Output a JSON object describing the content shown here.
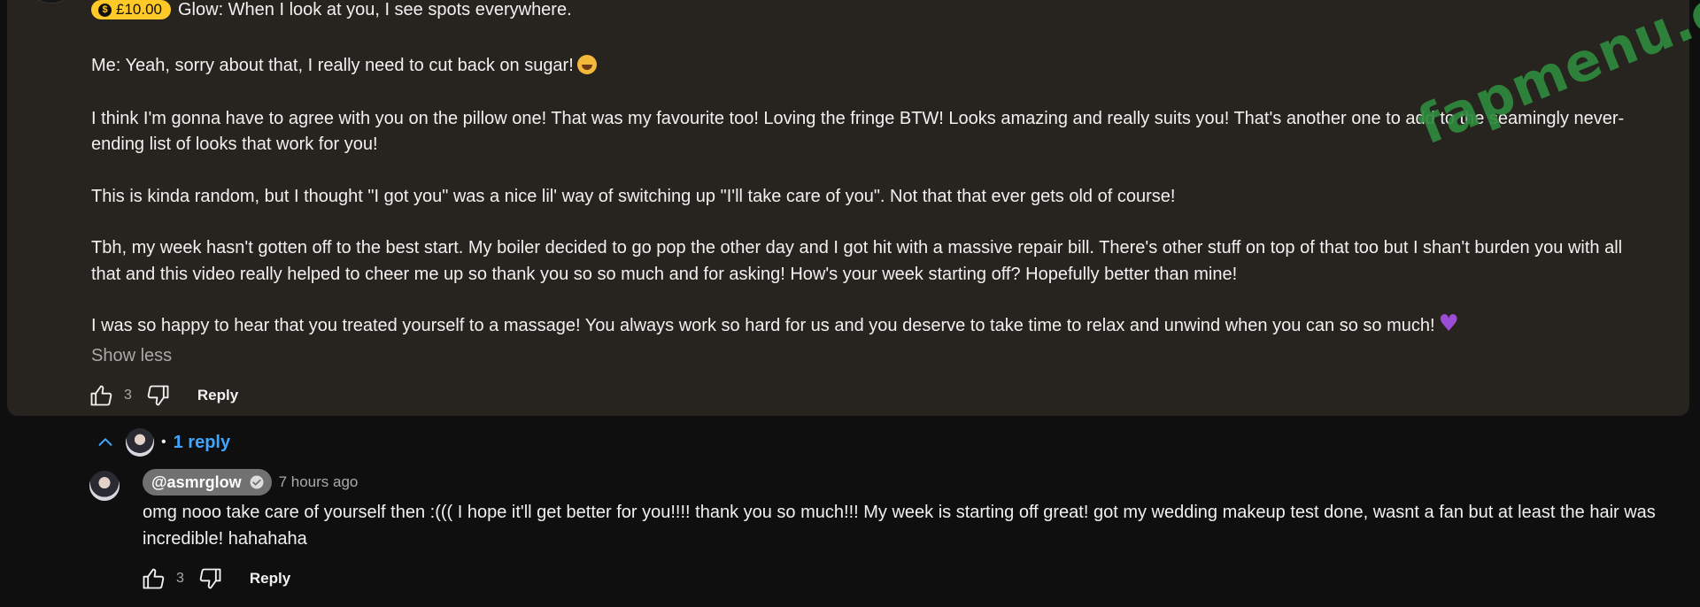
{
  "comment": {
    "super_chat_amount": "£10.00",
    "paragraphs": [
      "Glow: When I look at you, I see spots everywhere.",
      "Me: Yeah, sorry about that, I really need to cut back on sugar!",
      "I think I'm gonna have to agree with you on the pillow one! That was my favourite too! Loving the fringe BTW! Looks amazing and really suits you! That's another one to add to the seamingly never-ending list of looks that work for you!",
      "This is kinda random, but I thought \"I got you\" was a nice lil' way of switching up \"I'll take care of you\". Not that that ever gets old of course!",
      "Tbh, my week hasn't gotten off to the best start. My boiler decided to go pop the other day and I got hit with a massive repair bill. There's other stuff on top of that too but I shan't burden you with all that and this video really helped to cheer me up so thank you so so much and for asking! How's your week starting off? Hopefully better than mine!",
      "I was so happy to hear that you treated yourself to a massage! You always work so hard for us and you deserve to take time to relax and unwind when you can so so much!"
    ],
    "show_less_label": "Show less",
    "like_count": "3",
    "reply_label": "Reply"
  },
  "replies_toggle": {
    "separator": "•",
    "count_label": "1 reply"
  },
  "reply": {
    "handle": "@asmrglow",
    "time": "7 hours ago",
    "text": "omg nooo take care of yourself then :((( I hope it'll get better for you!!!! thank you so much!!! My week is starting off great! got my wedding makeup test done, wasnt a fan but at least the hair was incredible! hahahaha",
    "like_count": "3",
    "reply_label": "Reply"
  },
  "watermark": {
    "text": "fapmenu.com",
    "color": "#2f8a3e"
  },
  "colors": {
    "card_bg": "#27231e",
    "page_bg": "#0f0f0f",
    "super_chat": "#ffca28",
    "link": "#3ea6ff"
  }
}
